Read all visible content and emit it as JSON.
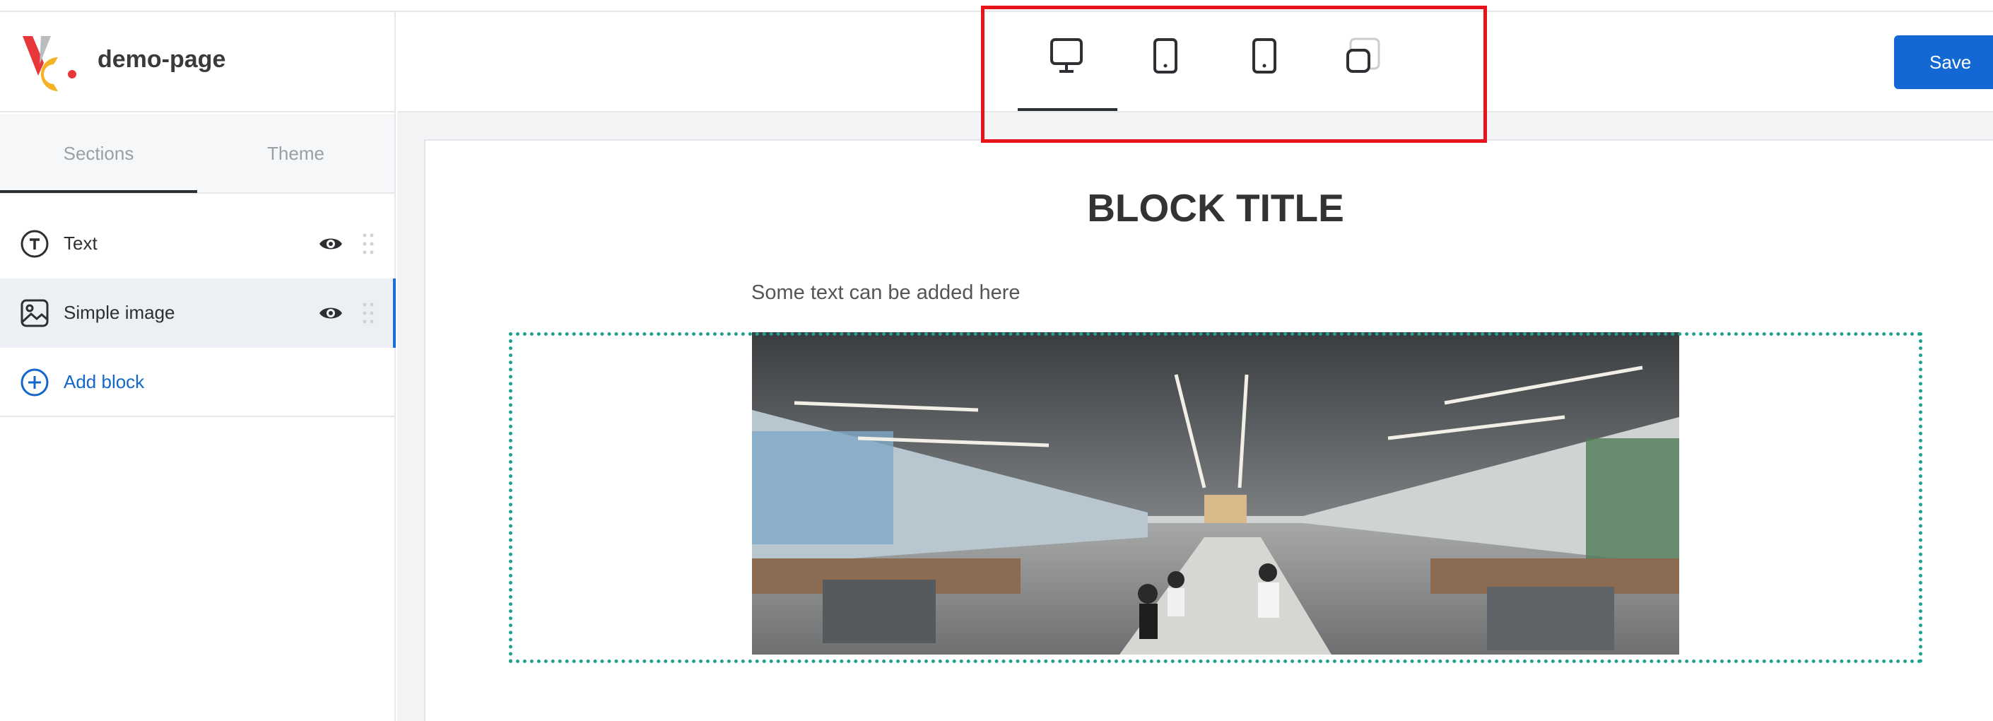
{
  "app": {
    "page_name": "demo-page"
  },
  "sidebar": {
    "tabs": [
      {
        "label": "Sections",
        "active": true
      },
      {
        "label": "Theme",
        "active": false
      }
    ],
    "blocks": [
      {
        "label": "Text",
        "icon": "text-circle-icon",
        "visible": true,
        "selected": false
      },
      {
        "label": "Simple image",
        "icon": "image-icon",
        "visible": true,
        "selected": true
      }
    ],
    "add_block_label": "Add block"
  },
  "toolbar": {
    "devices": [
      {
        "name": "desktop-icon",
        "active": true
      },
      {
        "name": "tablet-icon",
        "active": false
      },
      {
        "name": "mobile-icon",
        "active": false
      },
      {
        "name": "fit-to-screen-icon",
        "active": false
      }
    ],
    "save_label": "Save"
  },
  "preview": {
    "block_title": "BLOCK TITLE",
    "body_text": "Some text can be added here",
    "image_alt": "office-photo"
  },
  "colors": {
    "accent": "#1468d4",
    "highlight": "#e8141b",
    "selection": "#1fa28f",
    "logo_red": "#e8373a",
    "logo_yellow": "#f5b324",
    "logo_gray": "#b9bcc1"
  }
}
